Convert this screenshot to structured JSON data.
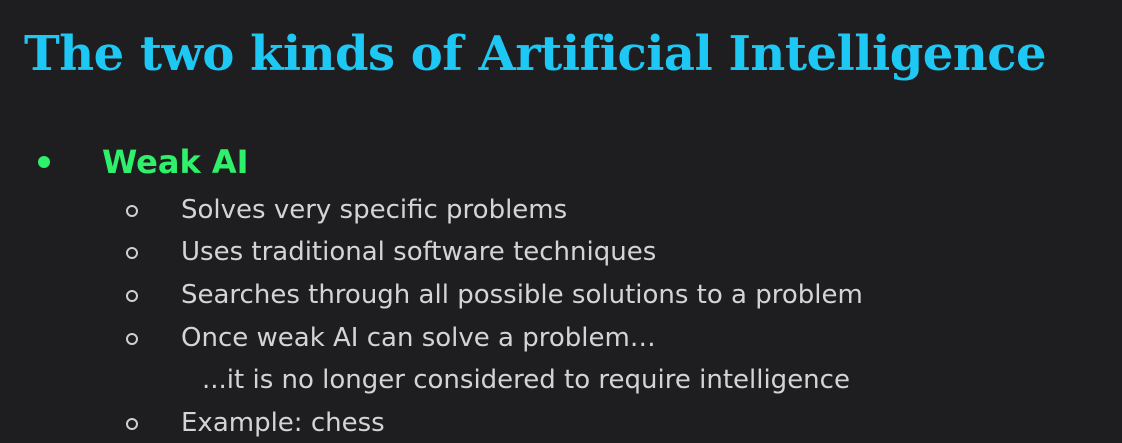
{
  "slide": {
    "title": "The two kinds of Artificial Intelligence",
    "bullet": {
      "label": "Weak AI",
      "items": [
        "Solves very specific problems",
        "Uses traditional software techniques",
        "Searches through all possible solutions to a problem",
        "Once weak AI can solve a problem…",
        "Example: chess"
      ],
      "continuation": "...it is no longer considered to require intelligence"
    }
  },
  "colors": {
    "background": "#1e1e20",
    "title": "#1ec8f5",
    "bullet_heading": "#2ef06a",
    "body_text": "#d4d4d4"
  }
}
